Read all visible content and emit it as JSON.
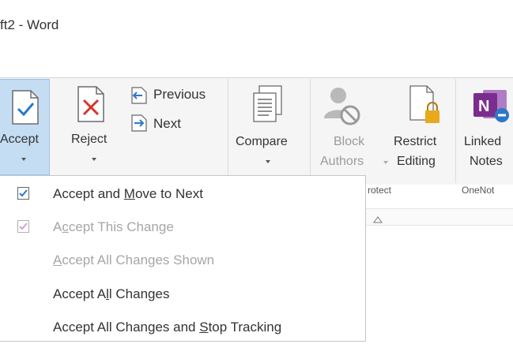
{
  "window": {
    "title": "ft2 - Word"
  },
  "ribbon": {
    "accept": {
      "label": "Accept"
    },
    "reject": {
      "label": "Reject"
    },
    "previous": {
      "label": "Previous"
    },
    "next": {
      "label": "Next"
    },
    "compare": {
      "label": "Compare"
    },
    "block_authors": {
      "line1": "Block",
      "line2": "Authors"
    },
    "restrict_editing": {
      "line1": "Restrict",
      "line2": "Editing"
    },
    "linked_notes": {
      "line1": "Linked",
      "line2": "Notes"
    },
    "groups": {
      "protect": "rotect",
      "onenote": "OneNot"
    }
  },
  "accept_menu": {
    "items": [
      {
        "before": "Accept and ",
        "key": "M",
        "after": "ove to Next",
        "enabled": true,
        "icon": "accept-check-icon"
      },
      {
        "before": "A",
        "key": "c",
        "after": "cept This Change",
        "enabled": false,
        "icon": "accept-check-icon"
      },
      {
        "before": "",
        "key": "A",
        "after": "ccept All Changes Shown",
        "enabled": false,
        "icon": ""
      },
      {
        "before": "Accept A",
        "key": "l",
        "after": "l Changes",
        "enabled": true,
        "icon": ""
      },
      {
        "before": "Accept All Changes and ",
        "key": "S",
        "after": "top Tracking",
        "enabled": true,
        "icon": ""
      }
    ]
  },
  "colors": {
    "accent_blue": "#2b78c9",
    "reject_red": "#d9342b",
    "onenote_purple": "#7b2d8e",
    "lock_gold": "#e8a91c",
    "selected_bg": "#c5ddf3"
  }
}
